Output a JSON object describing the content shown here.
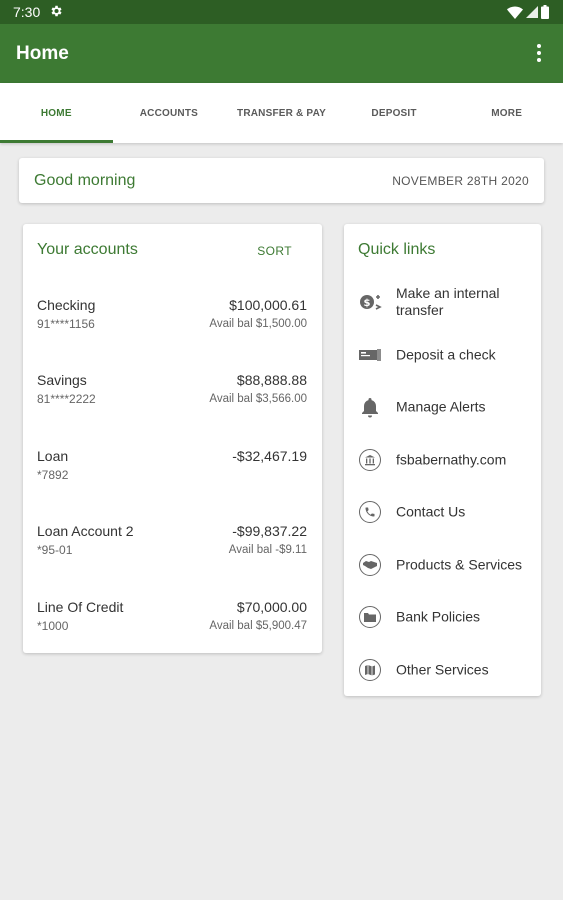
{
  "status_bar": {
    "time": "7:30"
  },
  "app_bar": {
    "title": "Home"
  },
  "tabs": [
    {
      "label": "HOME",
      "active": true
    },
    {
      "label": "ACCOUNTS",
      "active": false
    },
    {
      "label": "TRANSFER & PAY",
      "active": false
    },
    {
      "label": "DEPOSIT",
      "active": false
    },
    {
      "label": "MORE",
      "active": false
    }
  ],
  "greeting": {
    "text": "Good morning",
    "date": "NOVEMBER 28TH 2020"
  },
  "accounts": {
    "title": "Your accounts",
    "sort_label": "SORT",
    "items": [
      {
        "name": "Checking",
        "number": "91****1156",
        "balance": "$100,000.61",
        "available": "Avail bal $1,500.00"
      },
      {
        "name": "Savings",
        "number": "81****2222",
        "balance": "$88,888.88",
        "available": "Avail bal $3,566.00"
      },
      {
        "name": "Loan",
        "number": "*7892",
        "balance": "-$32,467.19",
        "available": ""
      },
      {
        "name": "Loan Account 2",
        "number": "*95-01",
        "balance": "-$99,837.22",
        "available": "Avail bal -$9.11"
      },
      {
        "name": "Line Of Credit",
        "number": "*1000",
        "balance": "$70,000.00",
        "available": "Avail bal $5,900.47"
      }
    ]
  },
  "quick_links": {
    "title": "Quick links",
    "items": [
      {
        "label": "Make an internal transfer",
        "icon": "transfer-icon"
      },
      {
        "label": "Deposit a check",
        "icon": "check-deposit-icon"
      },
      {
        "label": "Manage Alerts",
        "icon": "bell-icon"
      },
      {
        "label": "fsbabernathy.com",
        "icon": "bank-icon"
      },
      {
        "label": "Contact Us",
        "icon": "phone-icon"
      },
      {
        "label": "Products & Services",
        "icon": "handshake-icon"
      },
      {
        "label": "Bank Policies",
        "icon": "folder-icon"
      },
      {
        "label": "Other Services",
        "icon": "map-icon"
      }
    ]
  },
  "colors": {
    "status_bar": "#2d5e24",
    "app_bar": "#3d7a33",
    "accent": "#3d7a33",
    "background": "#ececec"
  }
}
